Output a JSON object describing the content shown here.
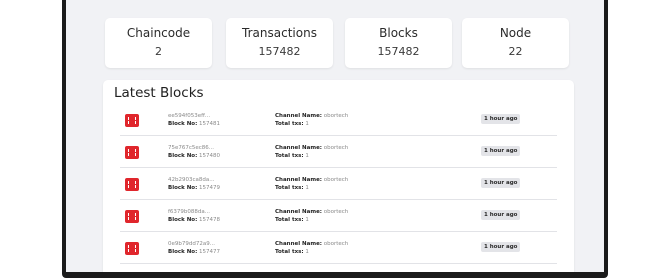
{
  "stats": [
    {
      "title": "Chaincode",
      "value": "2"
    },
    {
      "title": "Transactions",
      "value": "157482"
    },
    {
      "title": "Blocks",
      "value": "157482"
    },
    {
      "title": "Node",
      "value": "22"
    }
  ],
  "latest_blocks": {
    "title": "Latest Blocks",
    "block_no_label": "Block No:",
    "channel_label": "Channel Name:",
    "txs_label": "Total txs:",
    "rows": [
      {
        "hash": "ee594f053eff...",
        "block_no": "157481",
        "channel": "obortech",
        "txs": "1",
        "time": "1 hour ago"
      },
      {
        "hash": "75e767c5ec86...",
        "block_no": "157480",
        "channel": "obortech",
        "txs": "1",
        "time": "1 hour ago"
      },
      {
        "hash": "42b2903ca8da...",
        "block_no": "157479",
        "channel": "obortech",
        "txs": "1",
        "time": "1 hour ago"
      },
      {
        "hash": "f6379b088da...",
        "block_no": "157478",
        "channel": "obortech",
        "txs": "1",
        "time": "1 hour ago"
      },
      {
        "hash": "0e9b79dd72a9...",
        "block_no": "157477",
        "channel": "obortech",
        "txs": "1",
        "time": "1 hour ago"
      }
    ]
  },
  "colors": {
    "block_icon": "#e0262c",
    "frame": "#1b1b1b",
    "background": "#f1f2f5"
  },
  "icons": {
    "block_icon": "cube-icon"
  }
}
